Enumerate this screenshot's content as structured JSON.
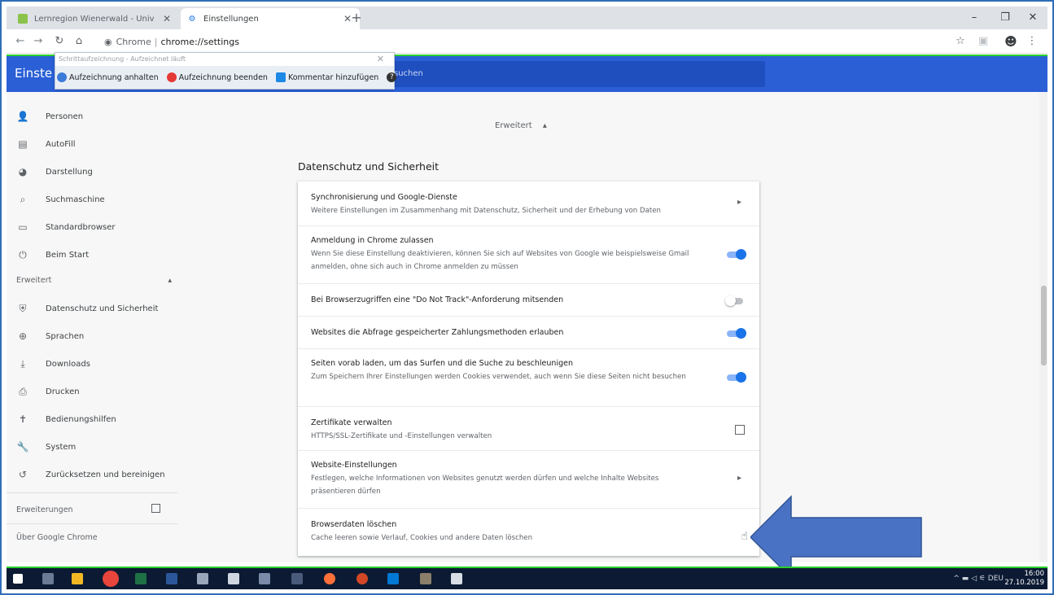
{
  "tabs": [
    {
      "title": "Lernregion Wienerwald - Univ",
      "active": false,
      "favicon_color": "#8bc34a"
    },
    {
      "title": "Einstellungen",
      "active": true,
      "favicon_color": "#1a73e8"
    }
  ],
  "window_controls": {
    "minimize": "–",
    "restore": "❐",
    "close": "✕"
  },
  "address": {
    "origin_label": "Chrome",
    "url": "chrome://settings"
  },
  "header": {
    "title": "Einste",
    "search_hint": "suchen"
  },
  "recorder": {
    "title": "Schrittaufzeichnung - Aufzeichnet läuft",
    "buttons": [
      {
        "label": "Aufzeichnung anhalten",
        "color": "#3b7bd8"
      },
      {
        "label": "Aufzeichnung beenden",
        "color": "#e53935"
      },
      {
        "label": "Kommentar hinzufügen",
        "color": "#1e88e5"
      }
    ],
    "help_label": "?"
  },
  "sidebar": {
    "items": [
      {
        "label": "Personen",
        "icon": "person-icon",
        "glyph": "👤"
      },
      {
        "label": "AutoFill",
        "icon": "clipboard-icon",
        "glyph": "▤"
      },
      {
        "label": "Darstellung",
        "icon": "palette-icon",
        "glyph": "◕"
      },
      {
        "label": "Suchmaschine",
        "icon": "search-icon",
        "glyph": "⌕"
      },
      {
        "label": "Standardbrowser",
        "icon": "browser-icon",
        "glyph": "▭"
      },
      {
        "label": "Beim Start",
        "icon": "power-icon",
        "glyph": "⏻"
      }
    ],
    "advanced_label": "Erweitert",
    "advanced_items": [
      {
        "label": "Datenschutz und Sicherheit",
        "icon": "shield-icon",
        "glyph": "⛨"
      },
      {
        "label": "Sprachen",
        "icon": "globe-icon",
        "glyph": "⊕"
      },
      {
        "label": "Downloads",
        "icon": "download-icon",
        "glyph": "⤓"
      },
      {
        "label": "Drucken",
        "icon": "printer-icon",
        "glyph": "⎙"
      },
      {
        "label": "Bedienungshilfen",
        "icon": "accessibility-icon",
        "glyph": "✝"
      },
      {
        "label": "System",
        "icon": "wrench-icon",
        "glyph": "🔧"
      },
      {
        "label": "Zurücksetzen und bereinigen",
        "icon": "reset-icon",
        "glyph": "↺"
      }
    ],
    "extensions_label": "Erweiterungen",
    "about_label": "Über Google Chrome"
  },
  "content": {
    "advanced_toggle": "Erweitert",
    "section_title": "Datenschutz und Sicherheit",
    "rows": [
      {
        "title": "Synchronisierung und Google-Dienste",
        "sub": "Weitere Einstellungen im Zusammenhang mit Datenschutz, Sicherheit und der Erhebung von Daten",
        "control": "arrow"
      },
      {
        "title": "Anmeldung in Chrome zulassen",
        "sub": "Wenn Sie diese Einstellung deaktivieren, können Sie sich auf Websites von Google wie beispielsweise Gmail anmelden, ohne sich auch in Chrome anmelden zu müssen",
        "control": "toggle-on"
      },
      {
        "title": "Bei Browserzugriffen eine \"Do Not Track\"-Anforderung mitsenden",
        "sub": "",
        "control": "toggle-off"
      },
      {
        "title": "Websites die Abfrage gespeicherter Zahlungsmethoden erlauben",
        "sub": "",
        "control": "toggle-on"
      },
      {
        "title": "Seiten vorab laden, um das Surfen und die Suche zu beschleunigen",
        "sub": "Zum Speichern Ihrer Einstellungen werden Cookies verwendet, auch wenn Sie diese Seiten nicht besuchen",
        "control": "toggle-on"
      },
      {
        "title": "Zertifikate verwalten",
        "sub": "HTTPS/SSL-Zertifikate und -Einstellungen verwalten",
        "control": "external"
      },
      {
        "title": "Website-Einstellungen",
        "sub": "Festlegen, welche Informationen von Websites genutzt werden dürfen und welche Inhalte Websites präsentieren dürfen",
        "control": "arrow"
      },
      {
        "title": "Browserdaten löschen",
        "sub": "Cache leeren sowie Verlauf, Cookies und andere Daten löschen",
        "control": "arrow"
      }
    ]
  },
  "taskbar": {
    "tray": "^ ▬ ◁ ⚟ DEU",
    "time": "16:00",
    "date": "27.10.2019"
  },
  "colors": {
    "header_blue": "#2a5fd6",
    "annotation_blue": "#4a72c4",
    "highlight_green": "#2bd02b"
  }
}
